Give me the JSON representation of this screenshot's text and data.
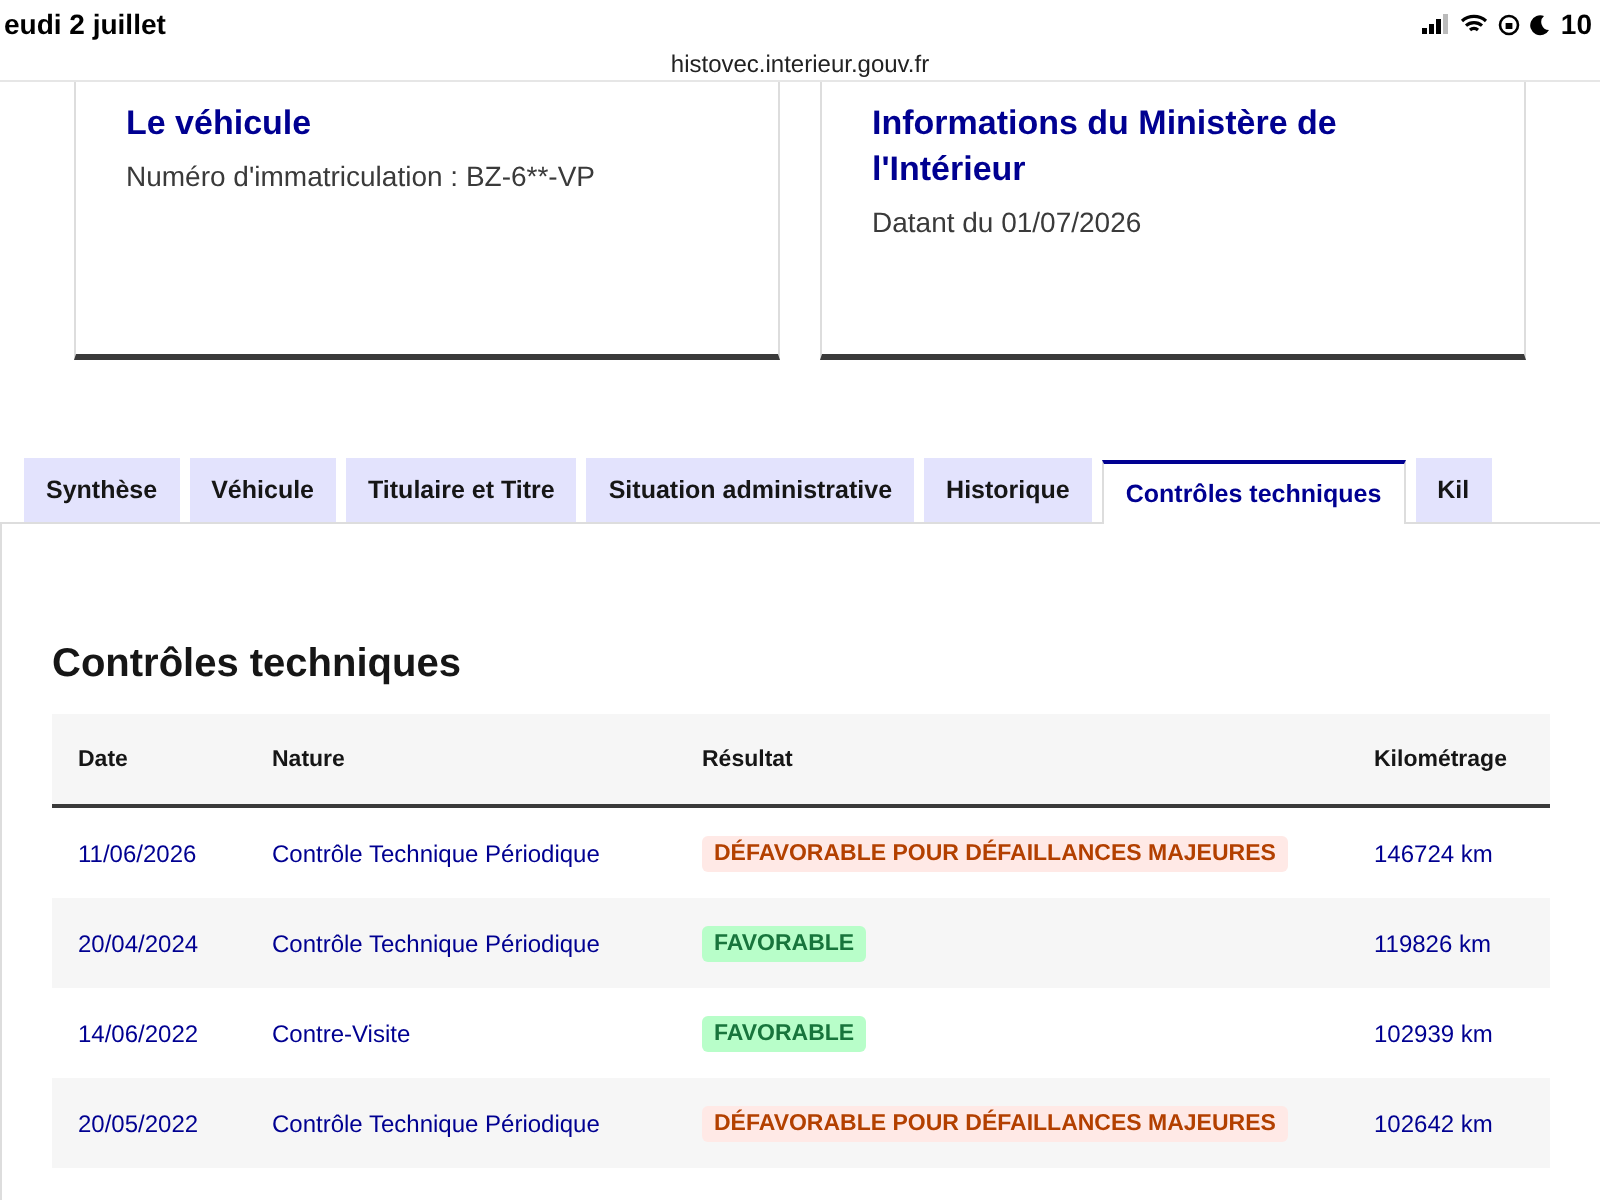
{
  "status_bar": {
    "date": "eudi 2 juillet",
    "battery": "10"
  },
  "url_bar": {
    "url": "histovec.interieur.gouv.fr"
  },
  "cards": [
    {
      "title": "Le véhicule",
      "text": "Numéro d'immatriculation : BZ-6**-VP"
    },
    {
      "title": "Informations du Ministère de l'Intérieur",
      "text": "Datant du 01/07/2026"
    }
  ],
  "tabs": [
    {
      "label": "Synthèse",
      "selected": false
    },
    {
      "label": "Véhicule",
      "selected": false
    },
    {
      "label": "Titulaire et Titre",
      "selected": false
    },
    {
      "label": "Situation administrative",
      "selected": false
    },
    {
      "label": "Historique",
      "selected": false
    },
    {
      "label": "Contrôles techniques",
      "selected": true
    },
    {
      "label": "Kil",
      "selected": false
    }
  ],
  "section": {
    "title": "Contrôles techniques"
  },
  "table": {
    "columns": [
      "Date",
      "Nature",
      "Résultat",
      "Kilométrage"
    ],
    "rows": [
      {
        "date": "11/06/2026",
        "nature": "Contrôle Technique Périodique",
        "result": "DÉFAVORABLE POUR DÉFAILLANCES MAJEURES",
        "kind": "unfavorable",
        "mileage": "146724 km"
      },
      {
        "date": "20/04/2024",
        "nature": "Contrôle Technique Périodique",
        "result": "FAVORABLE",
        "kind": "favorable",
        "mileage": "119826 km"
      },
      {
        "date": "14/06/2022",
        "nature": "Contre-Visite",
        "result": "FAVORABLE",
        "kind": "favorable",
        "mileage": "102939 km"
      },
      {
        "date": "20/05/2022",
        "nature": "Contrôle Technique Périodique",
        "result": "DÉFAVORABLE POUR DÉFAILLANCES MAJEURES",
        "kind": "unfavorable",
        "mileage": "102642 km"
      }
    ]
  }
}
